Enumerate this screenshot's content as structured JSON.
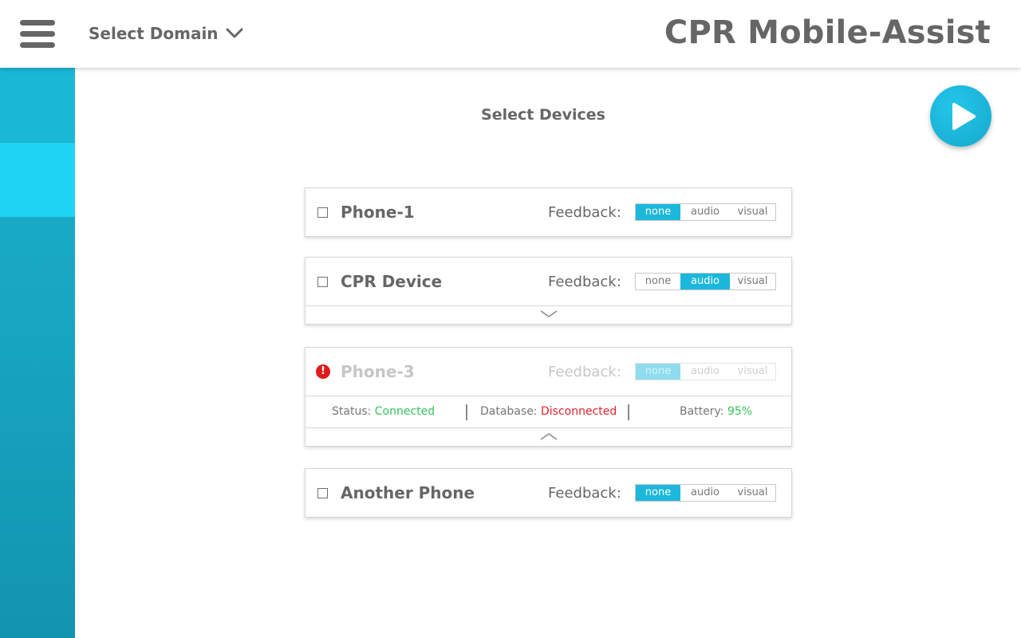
{
  "header": {
    "domain_label": "Select Domain",
    "app_title": "CPR Mobile-Assist"
  },
  "main": {
    "title": "Select Devices"
  },
  "devices": [
    {
      "name": "Phone-1",
      "feedback_label": "Feedback:",
      "options": [
        "none",
        "audio",
        "visual"
      ],
      "selected": "none",
      "status": "ok"
    },
    {
      "name": "CPR Device",
      "feedback_label": "Feedback:",
      "options": [
        "none",
        "audio",
        "visual"
      ],
      "selected": "audio",
      "status": "ok",
      "expandable": true
    },
    {
      "name": "Phone-3",
      "feedback_label": "Feedback:",
      "options": [
        "none",
        "audio",
        "visual"
      ],
      "selected": "none",
      "status": "error",
      "expanded": true,
      "details": {
        "status_label": "Status:",
        "status_value": "Connected",
        "database_label": "Database:",
        "database_value": "Disconnected",
        "battery_label": "Battery:",
        "battery_value": "95%"
      }
    },
    {
      "name": "Another Phone",
      "feedback_label": "Feedback:",
      "options": [
        "none",
        "audio",
        "visual"
      ],
      "selected": "none",
      "status": "ok"
    }
  ],
  "colors": {
    "accent": "#1cb8dc",
    "sidebar": "#17a4bf",
    "sidebar_active": "#1fd4f2",
    "ok": "#35c35a",
    "error": "#e0242a"
  },
  "icons": [
    "hamburger-menu-icon",
    "chevron-down-icon",
    "play-icon",
    "alert-icon",
    "chevron-up-icon"
  ]
}
